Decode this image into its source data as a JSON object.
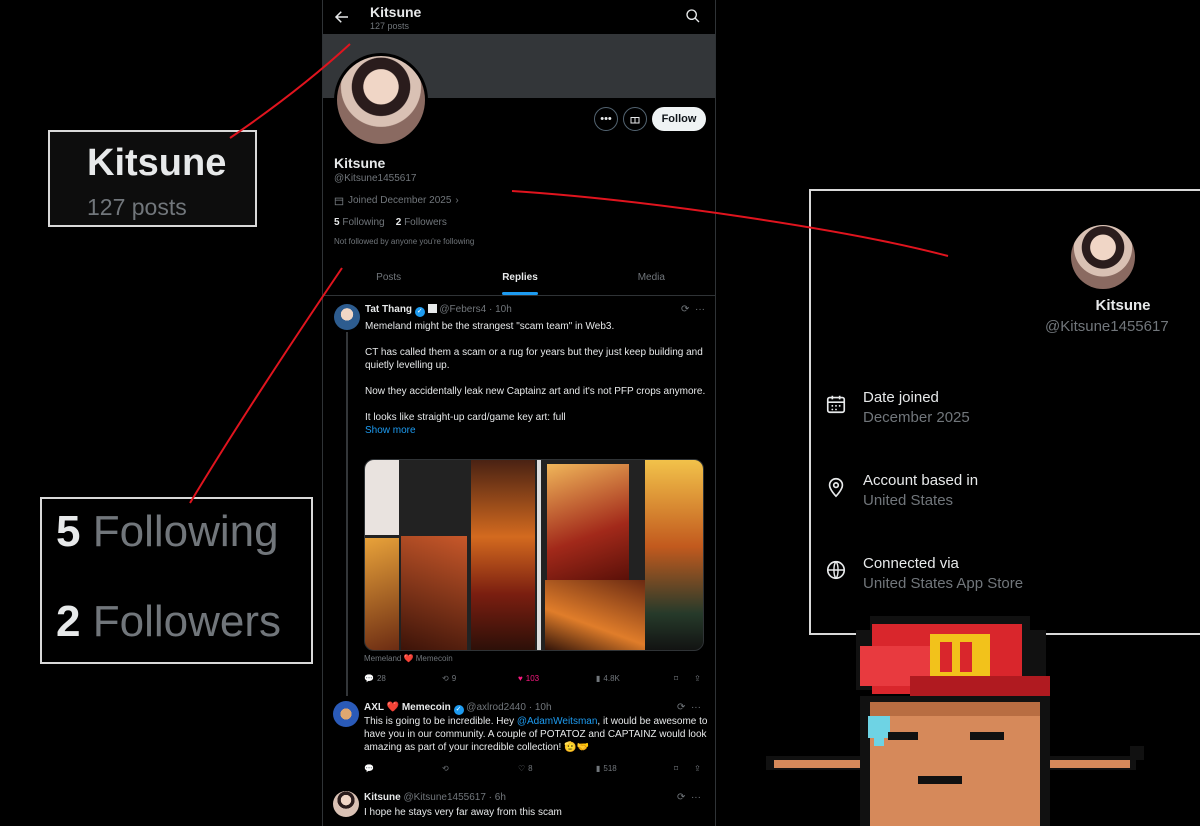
{
  "header": {
    "name": "Kitsune",
    "posts": "127 posts"
  },
  "profile": {
    "name": "Kitsune",
    "handle": "@Kitsune1455617",
    "joined": "Joined December 2025",
    "following_count": "5",
    "following_label": "Following",
    "followers_count": "2",
    "followers_label": "Followers",
    "not_followed": "Not followed by anyone you're following",
    "follow_label": "Follow"
  },
  "tabs": [
    {
      "label": "Posts"
    },
    {
      "label": "Replies"
    },
    {
      "label": "Media"
    }
  ],
  "tweets": [
    {
      "name": "Tat Thang",
      "handle": "@Febers4 · 10h",
      "paragraphs": [
        "Memeland might be the strangest \"scam team\" in Web3.",
        "CT has called them a scam or a rug for years but they just keep building and quietly levelling up.",
        "Now they accidentally leak new Captainz art and it's not PFP crops anymore.",
        "It looks like straight-up card/game key art: full"
      ],
      "show_more": "Show more",
      "footer": "Memeland ❤️ Memecoin",
      "replies": "28",
      "reposts": "9",
      "likes": "103",
      "views": "4.8K"
    },
    {
      "name": "AXL ❤️ Memecoin",
      "handle": "@axlrod2440 · 10h",
      "text_before": "This is going to be incredible. Hey ",
      "mention": "@AdamWeitsman",
      "text_after": ", it would be awesome to have you in our community. A couple of POTATOZ and CAPTAINZ would look amazing as part of your incredible collection! 🫡🤝",
      "replies": "",
      "reposts": "",
      "likes": "8",
      "views": "518"
    },
    {
      "name": "Kitsune",
      "handle": "@Kitsune1455617 · 6h",
      "text": "I hope he stays very far away from this scam"
    }
  ],
  "zoom_header": {
    "name": "Kitsune",
    "posts": "127 posts"
  },
  "zoom_follow": {
    "following_count": "5",
    "following_label": "Following",
    "followers_count": "2",
    "followers_label": "Followers"
  },
  "about": {
    "name": "Kitsune",
    "handle": "@Kitsune1455617",
    "rows": [
      {
        "icon": "calendar-icon",
        "label": "Date joined",
        "value": "December 2025"
      },
      {
        "icon": "location-pin-icon",
        "label": "Account based in",
        "value": "United States"
      },
      {
        "icon": "globe-icon",
        "label": "Connected via",
        "value": "United States App Store"
      }
    ]
  },
  "colors": {
    "accent": "#1d9bf0",
    "annotation": "#e0141e",
    "like": "#f91880"
  }
}
